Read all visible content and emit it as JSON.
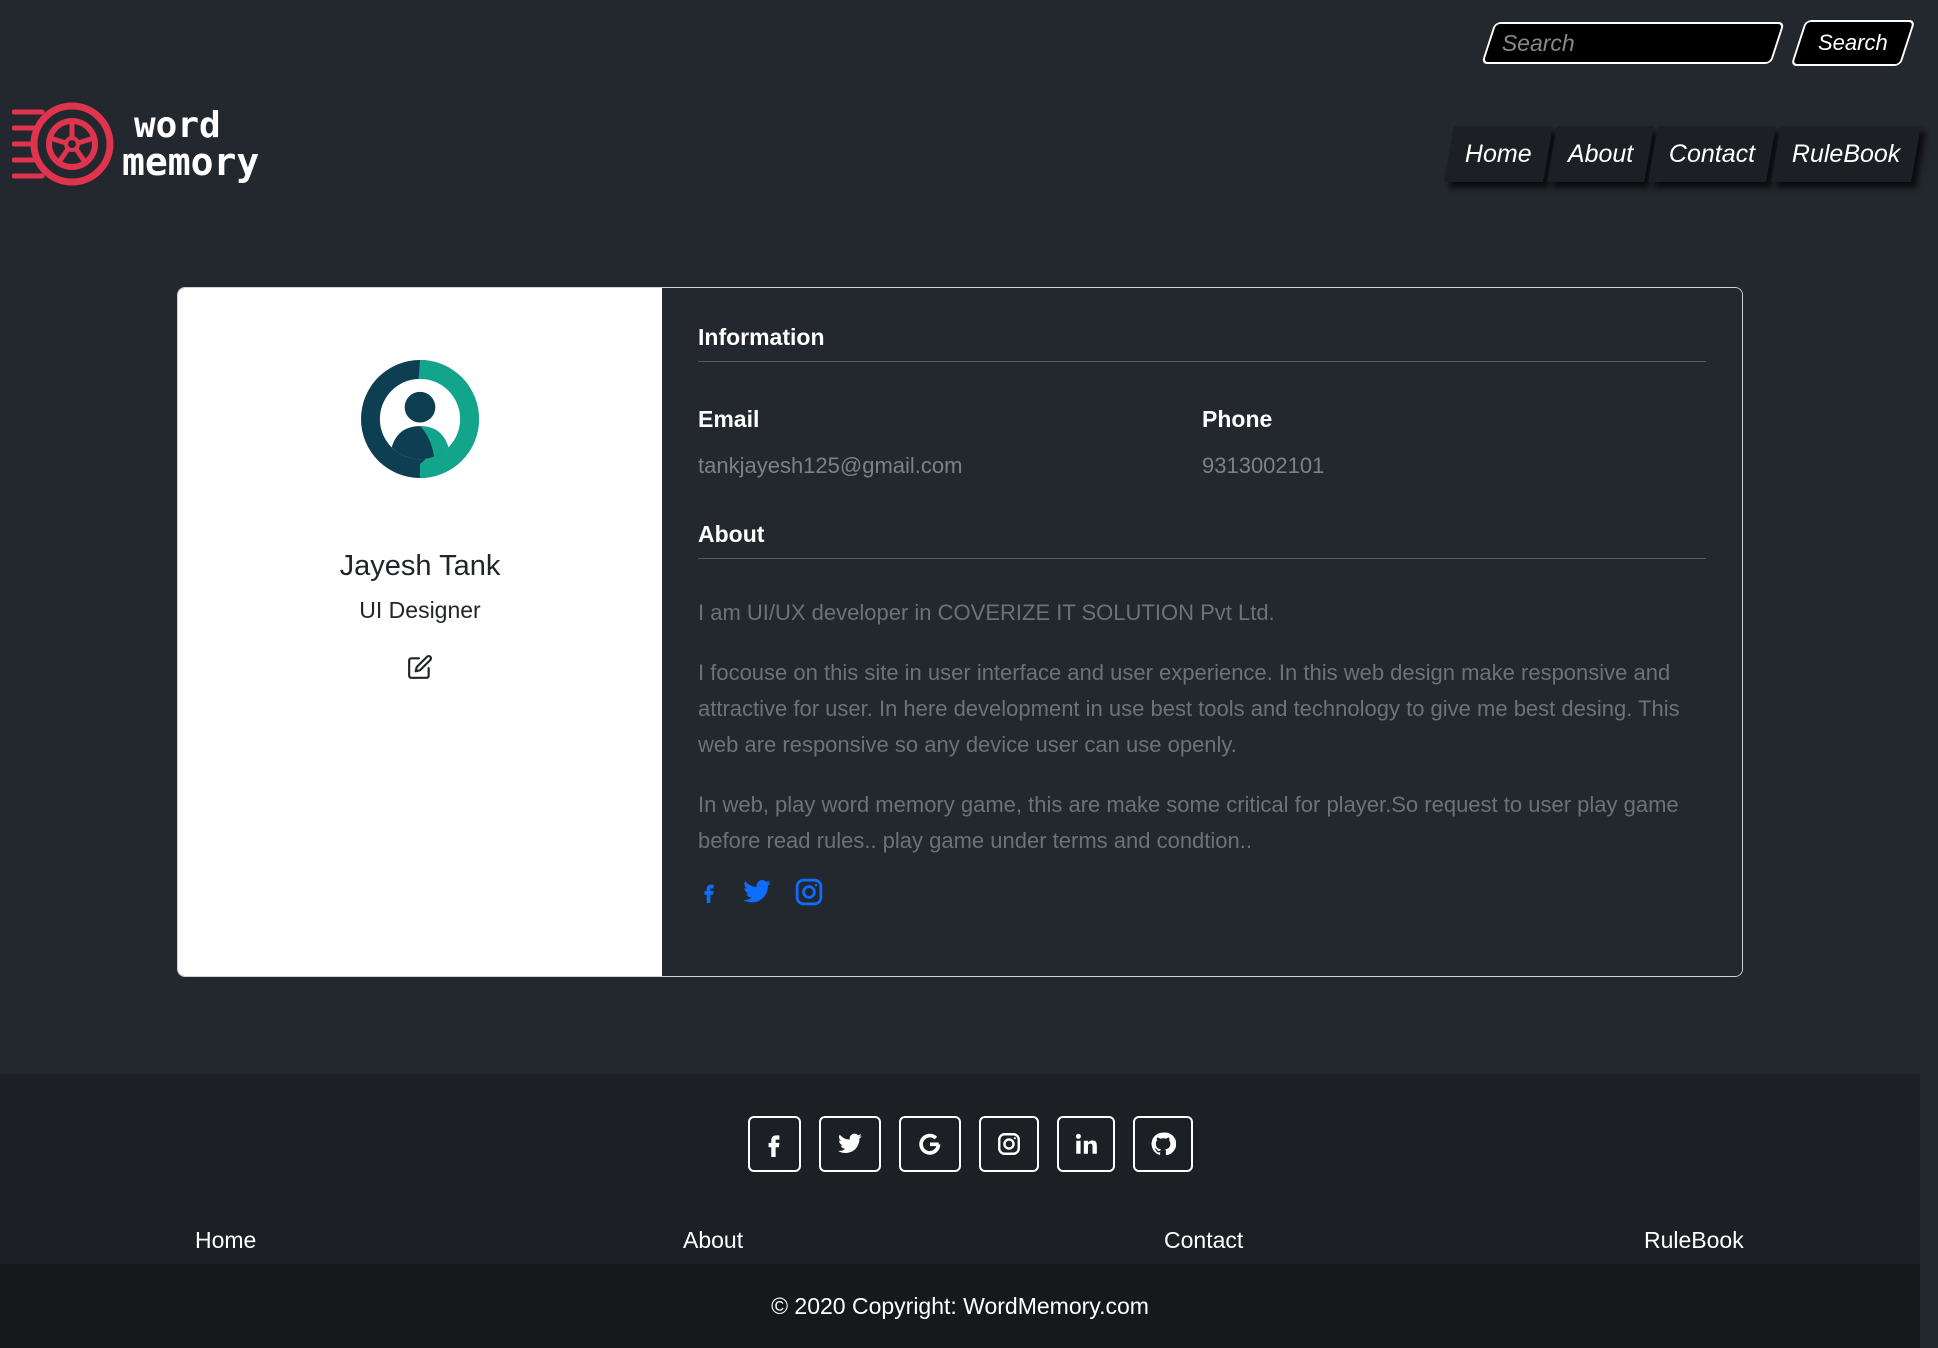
{
  "header": {
    "search_placeholder": "Search",
    "search_button": "Search",
    "logo": {
      "line1": "word",
      "line2": "memory"
    },
    "nav": [
      "Home",
      "About",
      "Contact",
      "RuleBook"
    ]
  },
  "profile": {
    "name": "Jayesh Tank",
    "role": "UI Designer",
    "avatar_icon": "user-avatar-icon",
    "edit_icon": "edit-icon"
  },
  "information": {
    "title": "Information",
    "email_label": "Email",
    "email_value": "tankjayesh125@gmail.com",
    "phone_label": "Phone",
    "phone_value": "9313002101"
  },
  "about": {
    "title": "About",
    "paragraphs": [
      "I am UI/UX developer in COVERIZE IT SOLUTION Pvt Ltd.",
      "I focouse on this site in user interface and user experience. In this web design make responsive and attractive for user. In here development in use best tools and technology to give me best desing. This web are responsive so any device user can use openly.",
      "In web, play word memory game, this are make some critical for player.So request to user play game before read rules.. play game under terms and condtion.."
    ],
    "social_icons": [
      "facebook-icon",
      "twitter-icon",
      "instagram-icon"
    ]
  },
  "footer": {
    "social_icons": [
      "facebook-icon",
      "twitter-icon",
      "google-icon",
      "instagram-icon",
      "linkedin-icon",
      "github-icon"
    ],
    "links": [
      "Home",
      "About",
      "Contact",
      "RuleBook"
    ],
    "copyright": "© 2020 Copyright: WordMemory.com"
  },
  "colors": {
    "background": "#23272e",
    "footer": "#1c1f24",
    "accent_blue": "#0d6efd",
    "logo_red": "#e0334e",
    "avatar_teal": "#12a58c",
    "avatar_dark": "#0e3e52"
  }
}
